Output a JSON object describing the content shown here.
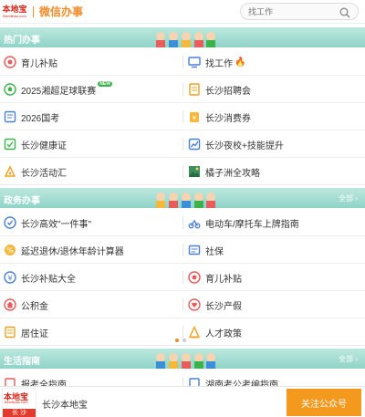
{
  "header": {
    "logo_line1": "本地宝",
    "logo_line2": "Bendibao.com",
    "title": "微信办事",
    "search_placeholder": "找工作"
  },
  "sections": [
    {
      "title": "热门办事",
      "more": ""
    },
    {
      "title": "政务办事",
      "more": "全部 ›"
    },
    {
      "title": "生活指南",
      "more": "全部 ›"
    }
  ],
  "hot_items": [
    {
      "label": "育儿补贴",
      "icon": "baby-subsidy-icon"
    },
    {
      "label": "找工作",
      "icon": "monitor-icon",
      "extra": "🔥"
    },
    {
      "label": "2025湘超足球联赛",
      "icon": "football-icon",
      "badge": "NEW"
    },
    {
      "label": "长沙招聘会",
      "icon": "job-fair-icon"
    },
    {
      "label": "2026国考",
      "icon": "exam-icon"
    },
    {
      "label": "长沙消费券",
      "icon": "coupon-icon"
    },
    {
      "label": "长沙健康证",
      "icon": "health-cert-icon"
    },
    {
      "label": "长沙夜校+技能提升",
      "icon": "night-school-icon"
    },
    {
      "label": "长沙活动汇",
      "icon": "activity-icon"
    },
    {
      "label": "橘子洲全攻略",
      "icon": "landscape-icon"
    }
  ],
  "gov_items": [
    {
      "label": "长沙高效\"一件事\"",
      "icon": "efficient-icon"
    },
    {
      "label": "电动车/摩托车上牌指南",
      "icon": "scooter-icon"
    },
    {
      "label": "延迟退休/退休年龄计算器",
      "icon": "calculator-icon"
    },
    {
      "label": "社保",
      "icon": "social-security-icon"
    },
    {
      "label": "长沙补贴大全",
      "icon": "subsidy-icon"
    },
    {
      "label": "育儿补贴",
      "icon": "baby-subsidy-icon"
    },
    {
      "label": "公积金",
      "icon": "housing-fund-icon"
    },
    {
      "label": "长沙产假",
      "icon": "maternity-leave-icon"
    },
    {
      "label": "居住证",
      "icon": "residence-permit-icon"
    },
    {
      "label": "人才政策",
      "icon": "talent-policy-icon"
    }
  ],
  "life_items": [
    {
      "label": "报考全指南"
    },
    {
      "label": "湖南考公考编指南"
    }
  ],
  "footer": {
    "logo_line1": "本地宝",
    "logo_line2": "Bendibao.com",
    "logo_city": "长 沙",
    "name": "长沙本地宝",
    "follow_label": "关注公众号"
  },
  "colors": {
    "accent": "#f08c2b",
    "banner": "#8fd3c8",
    "follow_button": "#f39a1e",
    "brand_red": "#d7261b"
  }
}
